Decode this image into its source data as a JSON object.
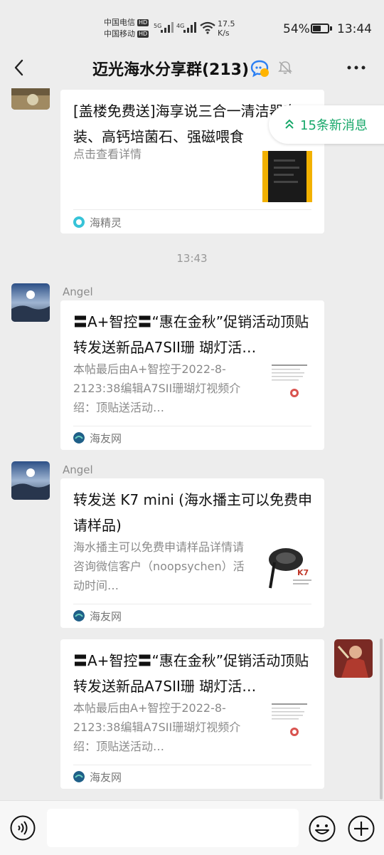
{
  "status": {
    "carrier1": "中国电信",
    "carrier2": "中国移动",
    "hd": "HD",
    "speed_value": "17.5",
    "speed_unit": "K/s",
    "battery": "54%",
    "battery_level": 0.54,
    "time": "13:44"
  },
  "header": {
    "title": "迈光海水分享群(213)"
  },
  "new_messages": "15条新消息",
  "timestamp": "13:43",
  "messages": [
    {
      "title": "[盖楼免费送]海享说三合一清洁器套装、高钙培菌石、强磁喂食",
      "desc": "点击查看详情",
      "source": "海精灵"
    },
    {
      "sender": "Angel",
      "title": "〓A+智控〓“惠在金秋”促销活动顶贴转发送新品A7SII珊 瑚灯活…",
      "desc": "本帖最后由A+智控于2022-8-2123:38编辑A7SII珊瑚灯视频介绍：顶贴送活动…",
      "source": "海友网"
    },
    {
      "sender": "Angel",
      "title": "转发送 K7 mini (海水播主可以免费申请样品)",
      "desc": "海水播主可以免费申请样品详情请咨询微信客户（noopsychen）活动时间…",
      "source": "海友网",
      "thumb_text": "K7"
    },
    {
      "title": "〓A+智控〓“惠在金秋”促销活动顶贴转发送新品A7SII珊 瑚灯活…",
      "desc": "本帖最后由A+智控于2022-8-2123:38编辑A7SII珊瑚灯视频介绍：顶贴送活动…",
      "source": "海友网"
    }
  ],
  "input": {
    "placeholder": ""
  },
  "icons": {
    "back": "chevron-left-icon",
    "more": "more-icon",
    "mute": "bell-off-icon",
    "voice": "voice-icon",
    "emoji": "emoji-icon",
    "plus": "plus-icon"
  },
  "colors": {
    "accent": "#17a86a",
    "background": "#ededed"
  }
}
